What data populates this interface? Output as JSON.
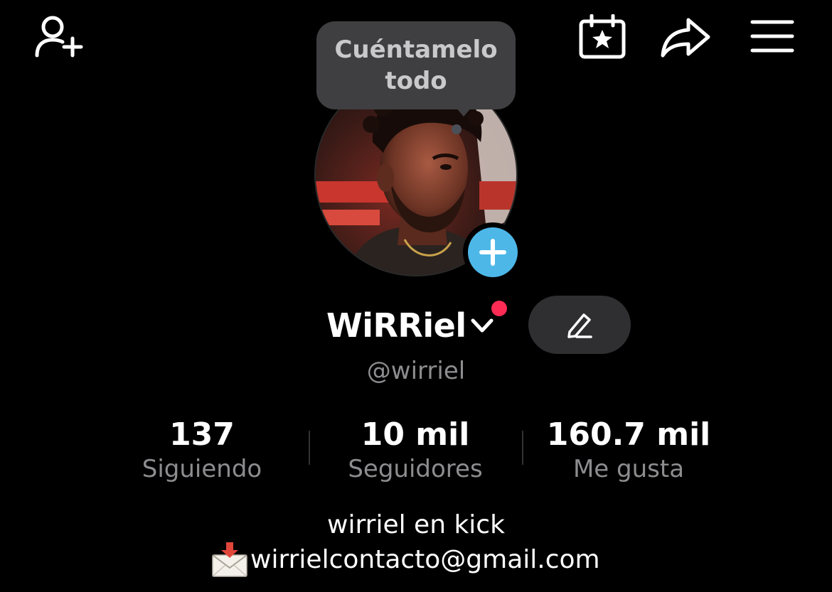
{
  "top_bar": {
    "icons": [
      "add-friend-icon",
      "calendar-star-icon",
      "share-icon",
      "menu-icon"
    ]
  },
  "tooltip": {
    "line1": "Cuéntamelo",
    "line2": "todo"
  },
  "profile": {
    "display_name": "WiRRiel",
    "handle": "@wirriel",
    "avatar_icon": "profile-photo",
    "add_story_icon": "plus-icon",
    "edit_icon": "pencil-icon"
  },
  "stats": [
    {
      "value": "137",
      "label": "Siguiendo"
    },
    {
      "value": "10 mil",
      "label": "Seguidores"
    },
    {
      "value": "160.7 mil",
      "label": "Me gusta"
    }
  ],
  "bio": {
    "line1": "wirriel en kick",
    "email": "wirrielcontacto@gmail.com",
    "email_icon": "envelope-with-arrow-icon"
  },
  "colors": {
    "background": "#000000",
    "accent_blue": "#4db7e8",
    "notification_red": "#fe2c55",
    "secondary_text": "#8d8d90",
    "button_bg": "#2f2f31",
    "tooltip_bg": "#3f3f41"
  }
}
